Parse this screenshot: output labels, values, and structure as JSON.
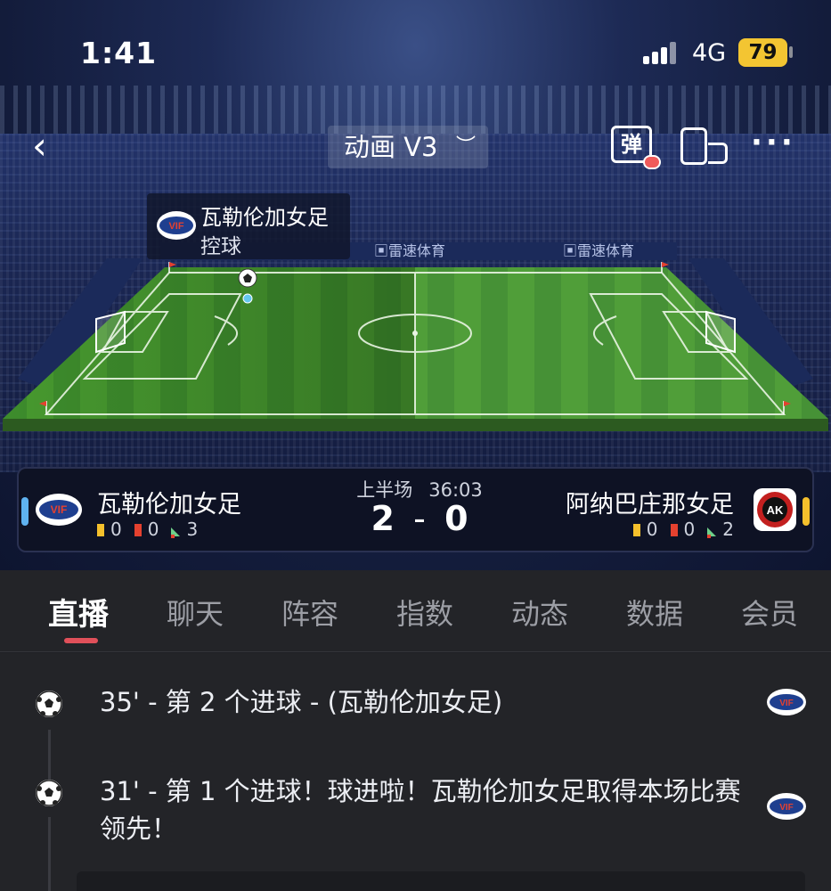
{
  "status_bar": {
    "time": "1:41",
    "network": "4G",
    "battery": "79"
  },
  "nav": {
    "title": "动画 V3",
    "danmu_label": "弹"
  },
  "possession": {
    "team": "瓦勒伦加女足",
    "state": "控球"
  },
  "pitch": {
    "sponsor": "雷速体育"
  },
  "match": {
    "period": "上半场",
    "clock": "36:03",
    "home": {
      "name": "瓦勒伦加女足",
      "yellow": "0",
      "red": "0",
      "corners": "3"
    },
    "away": {
      "name": "阿纳巴庄那女足",
      "yellow": "0",
      "red": "0",
      "corners": "2"
    },
    "home_score": "2",
    "away_score": "0",
    "separator": "-"
  },
  "tabs": [
    "直播",
    "聊天",
    "阵容",
    "指数",
    "动态",
    "数据",
    "会员"
  ],
  "events": [
    {
      "text": "35' - 第 2 个进球 - (瓦勒伦加女足)"
    },
    {
      "text": "31' - 第 1 个进球！球进啦！瓦勒伦加女足取得本场比赛领先！"
    }
  ],
  "colors": {
    "home_accent": "#5fb2f0",
    "away_accent": "#f5c02c",
    "tab_indicator": "#e0505a",
    "pitch_green": "#3f8f2e"
  }
}
